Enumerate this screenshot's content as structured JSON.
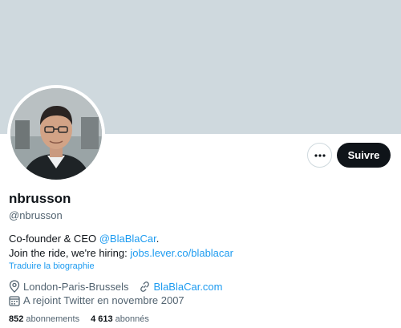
{
  "profile": {
    "name": "nbrusson",
    "handle": "@nbrusson",
    "bio_line1_prefix": "Co-founder & CEO ",
    "bio_line1_mention": "@BlaBlaCar",
    "bio_line1_suffix": ".",
    "bio_line2_prefix": "Join the ride, we're hiring: ",
    "bio_line2_link": "jobs.lever.co/blablacar",
    "translate_label": "Traduire la biographie",
    "location": "London-Paris-Brussels",
    "website": "BlaBlaCar.com",
    "joined": "A rejoint Twitter en novembre 2007"
  },
  "actions": {
    "more_icon": "more-horizontal-icon",
    "follow_label": "Suivre"
  },
  "stats": {
    "following_count": "852",
    "following_label": " abonnements",
    "followers_count": "4 613",
    "followers_label": " abonnés"
  },
  "colors": {
    "banner": "#cfd9de",
    "accent": "#1d9bf0",
    "primary_button": "#0f1419"
  }
}
